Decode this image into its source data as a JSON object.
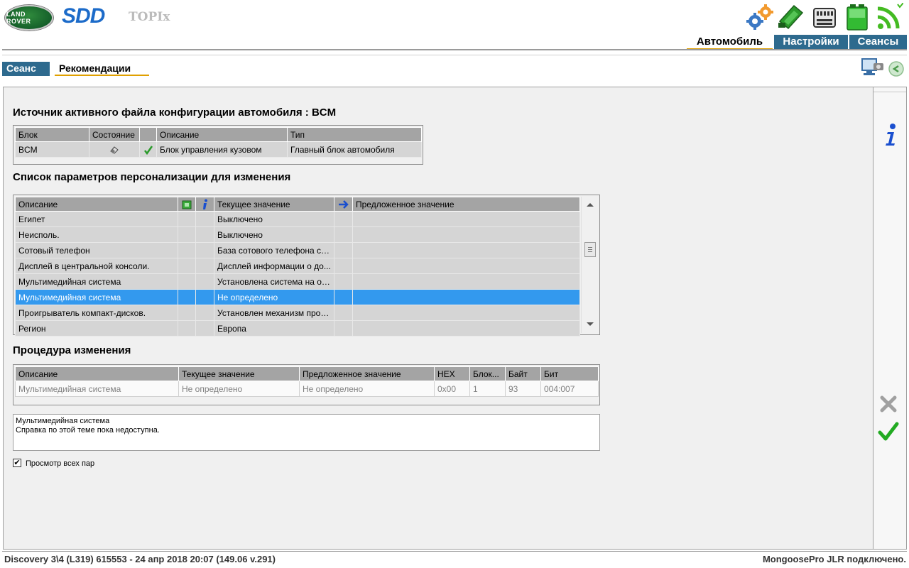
{
  "header": {
    "brand_logo": "LAND ROVER",
    "app_name": "SDD",
    "topix_label": "TOPIx",
    "icons": [
      "settings-gears-icon",
      "vehicle-interface-icon",
      "ecu-module-icon",
      "battery-icon",
      "wireless-signal-icon"
    ]
  },
  "nav": {
    "tabs": [
      {
        "label": "Автомобиль",
        "active": true
      },
      {
        "label": "Настройки",
        "active": false
      },
      {
        "label": "Сеансы",
        "active": false
      }
    ]
  },
  "subnav": {
    "tabs": [
      {
        "label": "Сеанс"
      },
      {
        "label": "Рекомендации",
        "active": true
      }
    ]
  },
  "source_section": {
    "title": "Источник активного файла конфигурации автомобиля : BCM",
    "columns": [
      "Блок",
      "Состояние",
      "",
      "Описание",
      "Тип"
    ],
    "rows": [
      {
        "block": "BCM",
        "state_icon": "eraser-icon",
        "ok_icon": "checkmark-icon",
        "description": "Блок управления кузовом",
        "type": "Главный блок автомобиля"
      }
    ]
  },
  "params_section": {
    "title": "Список параметров персонализации для изменения",
    "columns": [
      "Описание",
      "",
      "",
      "Текущее значение",
      "",
      "Предложенное значение"
    ],
    "column_icons": [
      "",
      "module-icon",
      "info-icon",
      "",
      "arrow-right-icon",
      ""
    ],
    "rows": [
      {
        "description": "Египет",
        "current": "Выключено",
        "proposed": ""
      },
      {
        "description": "Неисполь.",
        "current": "Выключено",
        "proposed": ""
      },
      {
        "description": "Сотовый телефон",
        "current": "База сотового телефона с b...",
        "proposed": ""
      },
      {
        "description": "Дисплей в центральной консоли.",
        "current": "Дисплей информации о до...",
        "proposed": ""
      },
      {
        "description": "Мультимедийная система",
        "current": "Установлена система на ос...",
        "proposed": ""
      },
      {
        "description": "Мультимедийная система",
        "current": "Не определено",
        "proposed": "",
        "selected": true
      },
      {
        "description": "Проигрыватель компакт-дисков.",
        "current": "Установлен механизм прои...",
        "proposed": ""
      },
      {
        "description": "Регион",
        "current": "Европа",
        "proposed": ""
      }
    ]
  },
  "procedure_section": {
    "title": "Процедура изменения",
    "columns": [
      "Описание",
      "Текущее значение",
      "Предложенное значение",
      "HEX",
      "Блок...",
      "Байт",
      "Бит"
    ],
    "rows": [
      {
        "description": "Мультимедийная система",
        "current": "Не определено",
        "proposed": "Не определено",
        "hex": "0x00",
        "block": "1",
        "byte": "93",
        "bit": "004:007"
      }
    ]
  },
  "help": {
    "title": "Мультимедийная система",
    "text": "Справка по этой теме пока недоступна."
  },
  "show_all_pairs": {
    "label": "Просмотр всех пар",
    "checked": true
  },
  "sidebar_right": {
    "icons": [
      "info-icon",
      "cancel-icon",
      "confirm-icon"
    ]
  },
  "status": {
    "left": "Discovery 3\\4 (L319) 615553 - 24 апр 2018 20:07 (149.06 v.291)",
    "right": "MongoosePro JLR подключено."
  },
  "colors": {
    "accent": "#2e6a8e",
    "tab_underline": "#e0a000",
    "selection": "#3399ee",
    "header_gray": "#a4a4a4"
  }
}
